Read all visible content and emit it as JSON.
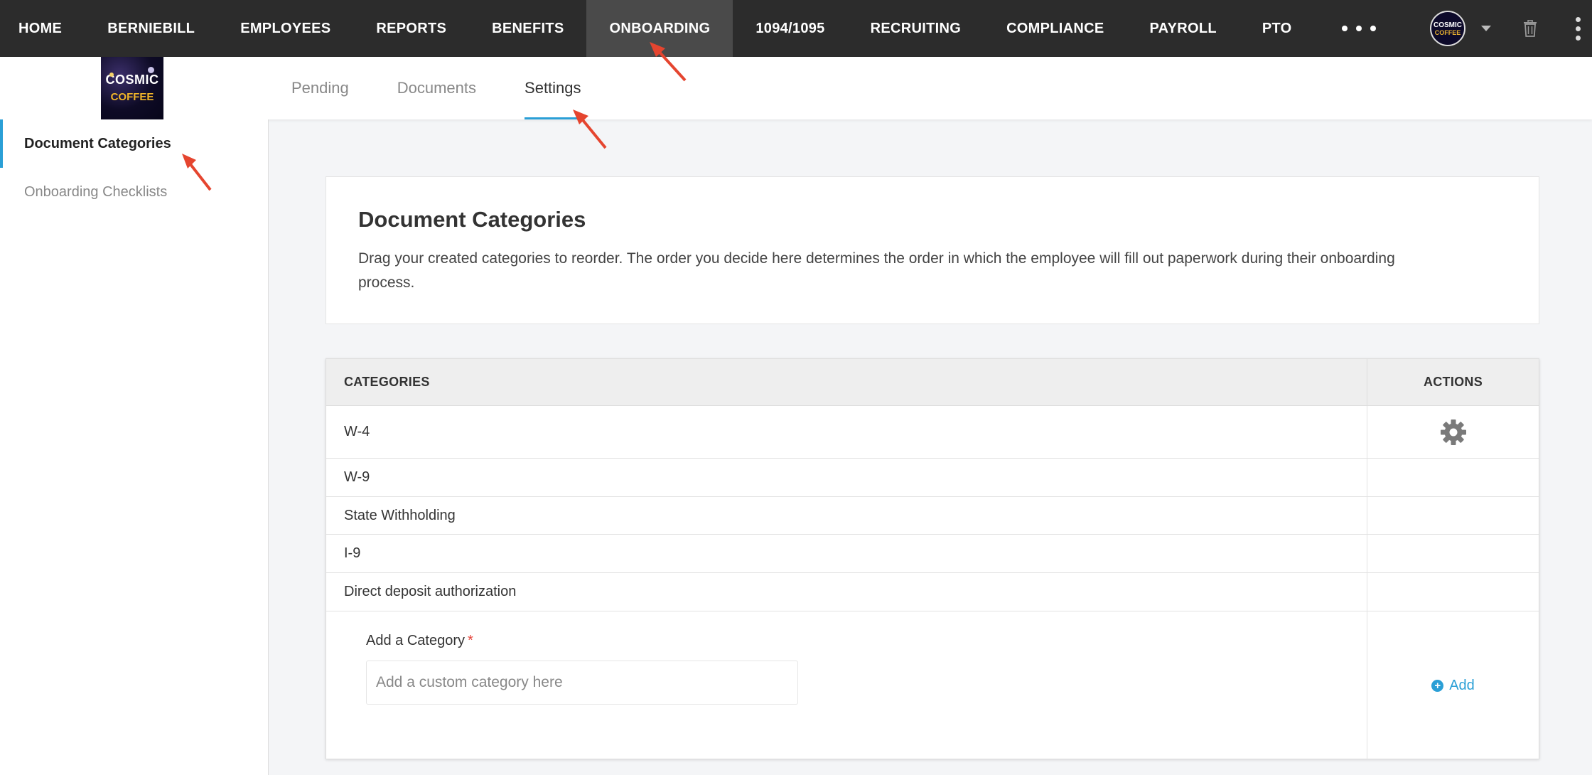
{
  "topnav": {
    "items": [
      {
        "label": "HOME"
      },
      {
        "label": "BERNIEBILL"
      },
      {
        "label": "EMPLOYEES"
      },
      {
        "label": "REPORTS"
      },
      {
        "label": "BENEFITS"
      },
      {
        "label": "ONBOARDING"
      },
      {
        "label": "1094/1095"
      },
      {
        "label": "RECRUITING"
      },
      {
        "label": "COMPLIANCE"
      },
      {
        "label": "PAYROLL"
      },
      {
        "label": "PTO"
      }
    ],
    "active": "ONBOARDING",
    "avatar": {
      "line1": "COSMIC",
      "line2": "COFFEE"
    }
  },
  "logo": {
    "line1": "COSMIC",
    "line2": "COFFEE"
  },
  "tabs": [
    {
      "label": "Pending"
    },
    {
      "label": "Documents"
    },
    {
      "label": "Settings"
    }
  ],
  "active_tab": "Settings",
  "sidebar": {
    "items": [
      {
        "label": "Document Categories"
      },
      {
        "label": "Onboarding Checklists"
      }
    ],
    "active": "Document Categories"
  },
  "intro": {
    "title": "Document Categories",
    "description": "Drag your created categories to reorder. The order you decide here determines the order in which the employee will fill out paperwork during their onboarding process."
  },
  "table": {
    "headers": {
      "categories": "CATEGORIES",
      "actions": "ACTIONS"
    },
    "rows": [
      {
        "name": "W-4"
      },
      {
        "name": "W-9"
      },
      {
        "name": "State Withholding"
      },
      {
        "name": "I-9"
      },
      {
        "name": "Direct deposit authorization"
      }
    ],
    "add": {
      "label": "Add a Category",
      "required_mark": "*",
      "placeholder": "Add a custom category here",
      "value": "",
      "button": "Add"
    }
  },
  "colors": {
    "accent": "#2a9fd6",
    "nav_bg": "#2c2c2c",
    "annotation": "#e5452f"
  }
}
